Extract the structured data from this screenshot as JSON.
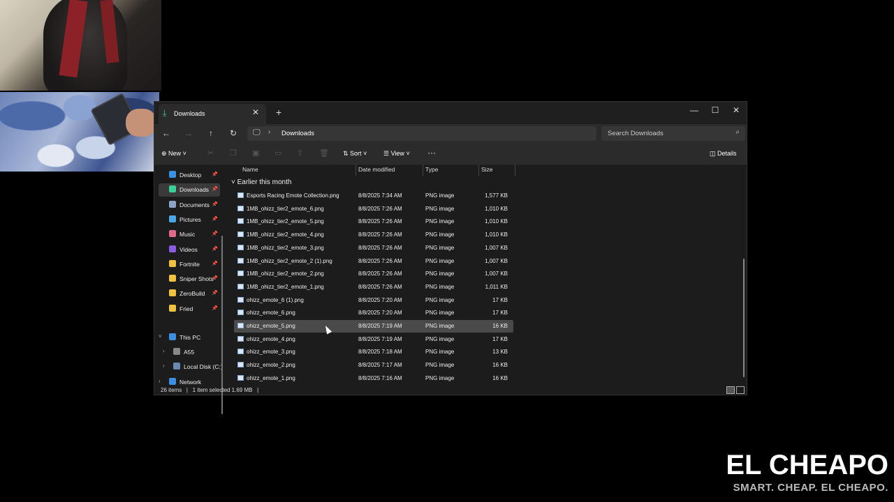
{
  "window": {
    "tab_title": "Downloads",
    "tab_close": "✕",
    "new_tab": "+",
    "controls": {
      "minimize": "—",
      "maximize": "☐",
      "close": "✕"
    }
  },
  "navbar": {
    "back": "←",
    "forward": "→",
    "up": "↑",
    "refresh": "↻",
    "breadcrumb": "Downloads",
    "search_placeholder": "Search Downloads"
  },
  "toolbar": {
    "new_label": "New",
    "sort_label": "Sort",
    "view_label": "View",
    "more": "···",
    "details_label": "Details"
  },
  "sidebar": {
    "pinned": [
      {
        "label": "Desktop",
        "color": "#3a8fe0"
      },
      {
        "label": "Downloads",
        "color": "#3ccf9a"
      },
      {
        "label": "Documents",
        "color": "#8aa4c8"
      },
      {
        "label": "Pictures",
        "color": "#4aa8e8"
      },
      {
        "label": "Music",
        "color": "#e06a8a"
      },
      {
        "label": "Videos",
        "color": "#8a5ae0"
      },
      {
        "label": "Fortnite",
        "color": "#f0c040"
      },
      {
        "label": "Sniper Shots",
        "color": "#f0c040"
      },
      {
        "label": "ZeroBuild",
        "color": "#f0c040"
      },
      {
        "label": "Fried",
        "color": "#f0c040"
      }
    ],
    "this_pc": "This PC",
    "drives": [
      {
        "label": "A55",
        "color": "#888888"
      },
      {
        "label": "Local Disk (C:)",
        "color": "#6a8ab0"
      }
    ],
    "network": "Network"
  },
  "columns": {
    "name": "Name",
    "date": "Date modified",
    "type": "Type",
    "size": "Size"
  },
  "group_label": "Earlier this month",
  "files": [
    {
      "name": "Esports Racing Emote Collection.png",
      "date": "8/8/2025 7:34 AM",
      "type": "PNG image",
      "size": "1,577 KB"
    },
    {
      "name": "1MB_ohizz_tier2_emote_6.png",
      "date": "8/8/2025 7:26 AM",
      "type": "PNG image",
      "size": "1,010 KB"
    },
    {
      "name": "1MB_ohizz_tier2_emote_5.png",
      "date": "8/8/2025 7:26 AM",
      "type": "PNG image",
      "size": "1,010 KB"
    },
    {
      "name": "1MB_ohizz_tier2_emote_4.png",
      "date": "8/8/2025 7:26 AM",
      "type": "PNG image",
      "size": "1,010 KB"
    },
    {
      "name": "1MB_ohizz_tier2_emote_3.png",
      "date": "8/8/2025 7:26 AM",
      "type": "PNG image",
      "size": "1,007 KB"
    },
    {
      "name": "1MB_ohizz_tier2_emote_2 (1).png",
      "date": "8/8/2025 7:26 AM",
      "type": "PNG image",
      "size": "1,007 KB"
    },
    {
      "name": "1MB_ohizz_tier2_emote_2.png",
      "date": "8/8/2025 7:26 AM",
      "type": "PNG image",
      "size": "1,007 KB"
    },
    {
      "name": "1MB_ohizz_tier2_emote_1.png",
      "date": "8/8/2025 7:26 AM",
      "type": "PNG image",
      "size": "1,011 KB"
    },
    {
      "name": "ohizz_emote_6 (1).png",
      "date": "8/8/2025 7:20 AM",
      "type": "PNG image",
      "size": "17 KB"
    },
    {
      "name": "ohizz_emote_6.png",
      "date": "8/8/2025 7:20 AM",
      "type": "PNG image",
      "size": "17 KB"
    },
    {
      "name": "ohizz_emote_5.png",
      "date": "8/8/2025 7:19 AM",
      "type": "PNG image",
      "size": "16 KB",
      "selected": true
    },
    {
      "name": "ohizz_emote_4.png",
      "date": "8/8/2025 7:19 AM",
      "type": "PNG image",
      "size": "17 KB"
    },
    {
      "name": "ohizz_emote_3.png",
      "date": "8/8/2025 7:18 AM",
      "type": "PNG image",
      "size": "13 KB"
    },
    {
      "name": "ohizz_emote_2.png",
      "date": "8/8/2025 7:17 AM",
      "type": "PNG image",
      "size": "16 KB"
    },
    {
      "name": "ohizz_emote_1.png",
      "date": "8/8/2025 7:16 AM",
      "type": "PNG image",
      "size": "16 KB"
    }
  ],
  "status": {
    "items": "26 items",
    "sep": "|",
    "selected": "1 item selected  1.69 MB",
    "end": "|"
  },
  "brand": {
    "title": "EL CHEAPO",
    "tagline": "SMART. CHEAP. EL CHEAPO."
  }
}
